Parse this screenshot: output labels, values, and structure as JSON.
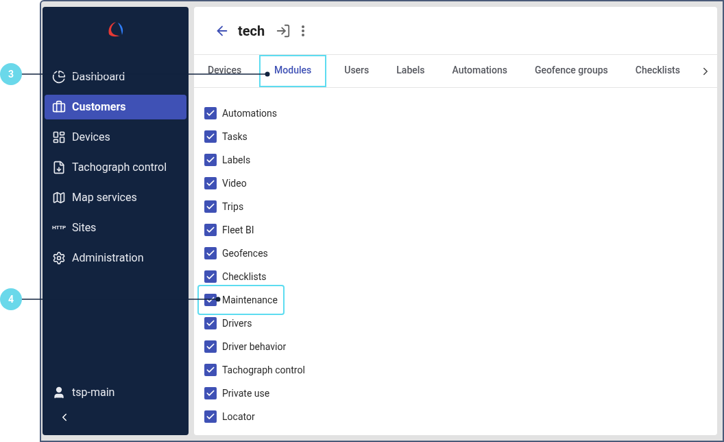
{
  "sidebar": {
    "items": [
      {
        "label": "Dashboard",
        "selected": false
      },
      {
        "label": "Customers",
        "selected": true
      },
      {
        "label": "Devices",
        "selected": false
      },
      {
        "label": "Tachograph control",
        "selected": false
      },
      {
        "label": "Map services",
        "selected": false
      },
      {
        "label": "Sites",
        "selected": false,
        "icon_text": "HTTP"
      },
      {
        "label": "Administration",
        "selected": false
      }
    ],
    "user": "tsp-main"
  },
  "header": {
    "title": "tech"
  },
  "tabs": [
    {
      "label": "Devices",
      "selected": false
    },
    {
      "label": "Modules",
      "selected": true
    },
    {
      "label": "Users",
      "selected": false
    },
    {
      "label": "Labels",
      "selected": false
    },
    {
      "label": "Automations",
      "selected": false
    },
    {
      "label": "Geofence groups",
      "selected": false
    },
    {
      "label": "Checklists",
      "selected": false
    }
  ],
  "modules": [
    {
      "label": "Automations",
      "checked": true
    },
    {
      "label": "Tasks",
      "checked": true
    },
    {
      "label": "Labels",
      "checked": true
    },
    {
      "label": "Video",
      "checked": true
    },
    {
      "label": "Trips",
      "checked": true
    },
    {
      "label": "Fleet BI",
      "checked": true
    },
    {
      "label": "Geofences",
      "checked": true
    },
    {
      "label": "Checklists",
      "checked": true
    },
    {
      "label": "Maintenance",
      "checked": true
    },
    {
      "label": "Drivers",
      "checked": true
    },
    {
      "label": "Driver behavior",
      "checked": true
    },
    {
      "label": "Tachograph control",
      "checked": true
    },
    {
      "label": "Private use",
      "checked": true
    },
    {
      "label": "Locator",
      "checked": true
    }
  ],
  "callouts": [
    {
      "label": "3"
    },
    {
      "label": "4"
    }
  ]
}
